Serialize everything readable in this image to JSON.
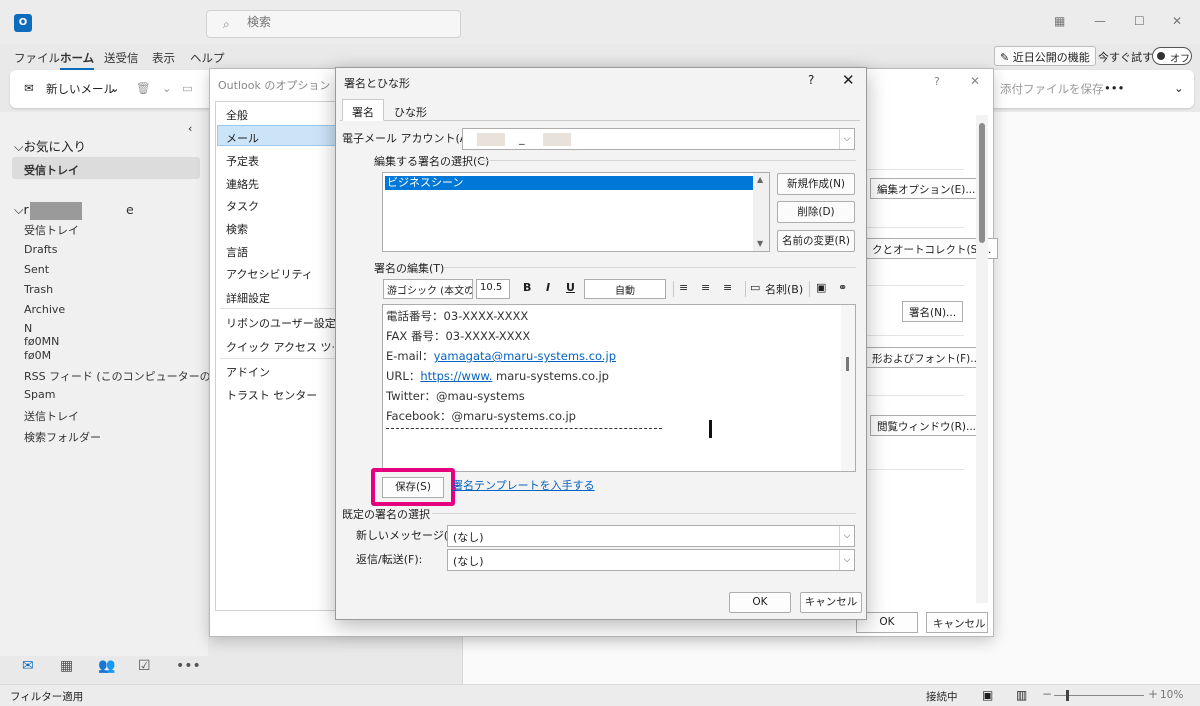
{
  "app": {
    "search_placeholder": "検索",
    "window_controls": [
      "▦",
      "—",
      "☐",
      "✕"
    ]
  },
  "ribbon_tabs": [
    "ファイル",
    "ホーム",
    "送受信",
    "表示",
    "ヘルプ"
  ],
  "ribbon_right": {
    "new_feature": "近日公開の機能",
    "try_now": "今すぐ試す",
    "toggle_label": "オフ"
  },
  "toolbar": {
    "new_mail": "新しいメール",
    "save_attachments": "添付ファイルを保存",
    "more": "•••"
  },
  "left_nav": {
    "favorites_header": "お気に入り",
    "favorites_inbox": "受信トレイ",
    "account_header_visible": "r",
    "account_header_tail": "e",
    "folders": [
      "受信トレイ",
      "Drafts",
      "Sent",
      "Trash",
      "Archive",
      "N",
      "fø0MN",
      "fø0M",
      "RSS フィード (このコンピューターのみ)",
      "Spam",
      "送信トレイ",
      "検索フォルダー"
    ]
  },
  "status_bar": {
    "filter": "フィルター適用",
    "connection": "接続中",
    "zoom": "10%"
  },
  "options_dialog": {
    "title": "Outlook のオプション",
    "help": "?",
    "close": "✕",
    "categories": [
      "全般",
      "メール",
      "予定表",
      "連絡先",
      "タスク",
      "検索",
      "言語",
      "アクセシビリティ",
      "詳細設定",
      "リボンのユーザー設定",
      "クイック アクセス ツール バー",
      "アドイン",
      "トラスト センター"
    ],
    "side_buttons": [
      "編集オプション(E)...",
      "クとオートコレクト(S)...",
      "署名(N)...",
      "形およびフォント(F)...",
      "閲覧ウィンドウ(R)..."
    ],
    "ok": "OK",
    "cancel": "キャンセル"
  },
  "signature_dialog": {
    "title": "署名とひな形",
    "help": "?",
    "close": "✕",
    "tabs": [
      "署名",
      "ひな形"
    ],
    "account_label": "電子メール アカウント(A):",
    "account_value": "_",
    "select_label": "編集する署名の選択(C)",
    "signatures": [
      "ビジネスシーン"
    ],
    "new_button": "新規作成(N)",
    "delete_button": "削除(D)",
    "rename_button": "名前の変更(R)",
    "edit_label": "署名の編集(T)",
    "font_name": "游ゴシック (本文の",
    "font_size": "10.5",
    "bold": "B",
    "italic": "I",
    "underline": "U",
    "color": "自動",
    "business_card": "名刺(B)",
    "body_lines": [
      {
        "prefix": "電話番号：03-XXXX-XXXX",
        "link": "",
        "suffix": ""
      },
      {
        "prefix": "FAX 番号：03-XXXX-XXXX",
        "link": "",
        "suffix": ""
      },
      {
        "prefix": "E-mail：",
        "link": "yamagata@maru-systems.co.jp",
        "suffix": ""
      },
      {
        "prefix": "URL：",
        "link": "https://www.",
        "suffix": " maru-systems.co.jp"
      },
      {
        "prefix": "Twitter：@mau-systems",
        "link": "",
        "suffix": ""
      },
      {
        "prefix": "Facebook：@maru-systems.co.jp",
        "link": "",
        "suffix": ""
      }
    ],
    "save_button": "保存(S)",
    "template_link": "署名テンプレートを入手する",
    "default_label": "既定の署名の選択",
    "new_messages_label": "新しいメッセージ(M):",
    "new_messages_value": "(なし)",
    "replies_label": "返信/転送(F):",
    "replies_value": "(なし)",
    "ok": "OK",
    "cancel": "キャンセル"
  },
  "colors": {
    "accent": "#0f6cbd",
    "highlight": "#e4007f",
    "selection": "#0078d7"
  }
}
